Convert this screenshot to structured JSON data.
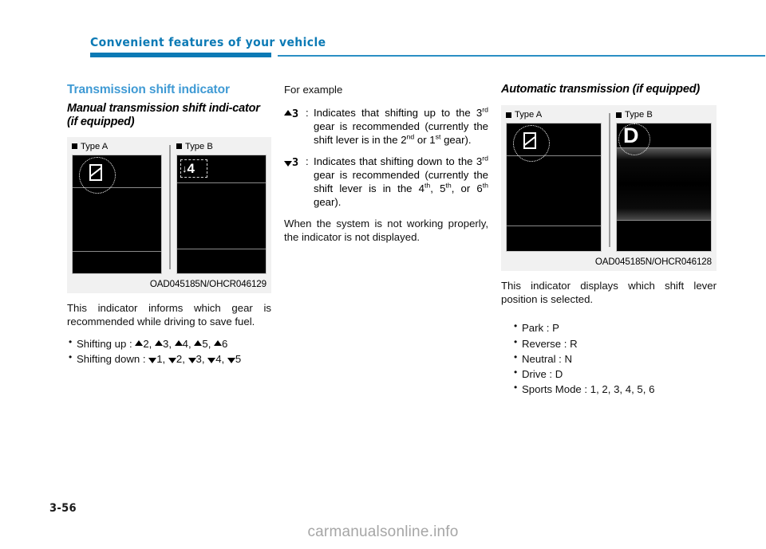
{
  "header": {
    "running_title": "Convenient features of your vehicle",
    "accent_color": "#0c7ab5"
  },
  "page_number": "3-56",
  "watermark": "carmanualsonline.info",
  "left_column": {
    "section_title": "Transmission shift indicator",
    "sub_title": "Manual transmission shift indi-cator (if equipped)",
    "figure": {
      "type_a_label": "Type A",
      "type_b_label": "Type B",
      "type_b_gear_arrow": "↓",
      "type_b_gear_number": "4",
      "caption": "OAD045185N/OHCR046129"
    },
    "paragraph": "This indicator informs which gear is recommended while driving to save fuel.",
    "bullets": [
      {
        "label": "Shifting up :",
        "direction": "up",
        "gears": [
          "2",
          "3",
          "4",
          "5",
          "6"
        ]
      },
      {
        "label": "Shifting down :",
        "direction": "down",
        "gears": [
          "1",
          "2",
          "3",
          "4",
          "5"
        ]
      }
    ]
  },
  "middle_column": {
    "intro": "For example",
    "definitions": [
      {
        "marker_direction": "up",
        "marker_gear": "3",
        "colon": ":",
        "text_parts": [
          "Indicates that shifting up to the 3",
          "rd",
          " gear is recommended (currently the shift lever is in the 2",
          "nd",
          " or 1",
          "st",
          " gear)."
        ]
      },
      {
        "marker_direction": "down",
        "marker_gear": "3",
        "colon": ":",
        "text_parts": [
          "Indicates that shifting down to the 3",
          "rd",
          " gear is recommended (currently the shift lever is in the 4",
          "th",
          ", 5",
          "th",
          ", or 6",
          "th",
          " gear)."
        ]
      }
    ],
    "closing_paragraph": "When the system is not working properly, the indicator is not displayed."
  },
  "right_column": {
    "sub_title": "Automatic transmission (if equipped)",
    "figure": {
      "type_a_label": "Type A",
      "type_b_label": "Type B",
      "type_b_letter": "D",
      "caption": "OAD045185N/OHCR046128"
    },
    "paragraph": "This indicator displays which shift lever position is selected.",
    "bullets": [
      "Park : P",
      "Reverse : R",
      "Neutral : N",
      "Drive : D",
      "Sports Mode : 1, 2, 3, 4, 5, 6"
    ]
  }
}
